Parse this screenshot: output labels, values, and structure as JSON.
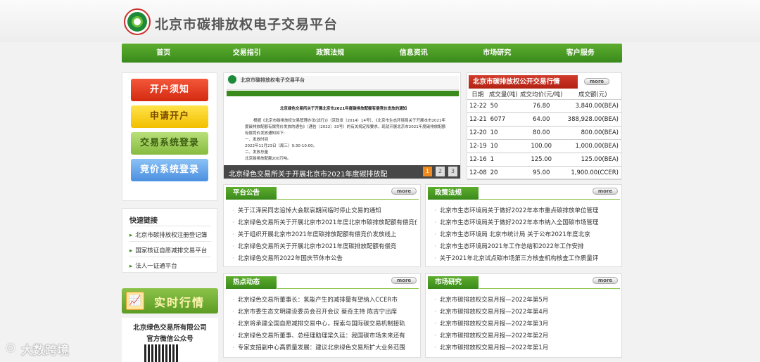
{
  "site_title": "北京市碳排放权电子交易平台",
  "nav": [
    "首页",
    "交易指引",
    "政策法规",
    "信息资讯",
    "市场研究",
    "客户服务"
  ],
  "buttons": {
    "open_notice": "开户须知",
    "apply": "申请开户",
    "trade_login": "交易系统登录",
    "bid_login": "竞价系统登录"
  },
  "quick_links": {
    "title": "快速链接",
    "items": [
      "北京市碳排放权注册登记簿",
      "国家核证自愿减排交易平台",
      "法人一证通平台"
    ]
  },
  "realtime": {
    "label": "实时行情"
  },
  "wechat": {
    "company": "北京绿色交易所有限公司",
    "label": "官方微信公众号"
  },
  "slide": {
    "site_title": "北京市碳排放权电子交易平台",
    "doc_title": "北京绿色交易所关于开展北京市2021年度碳排放配额有偿竞价发放的通知",
    "body": [
      "根据《北京市碳排放权交易管理办法(试行)》（京政发〔2014〕14号）、《北京市生态环境局关于开展本市2021年度碳排放配额有偿竞价发放的通告》（通告〔2022〕33号）的有关规定和要求，现就开展北京市2021年度碳排放配额有偿竞价发放通知如下:",
      "一、发放时间",
      "2022年11月23日（周三）9:30-10:00。",
      "二、发放总量",
      "北京碳排放配额200万吨。"
    ],
    "caption": "北京绿色交易所关于开展北京市2021年度碳排放配",
    "pages": [
      "1",
      "2",
      "3"
    ]
  },
  "market": {
    "title": "北京市碳排放权公开交易行情",
    "more": "more",
    "headers": [
      "日期",
      "成交量(吨)",
      "成交均价(元/吨)",
      "成交额(元)"
    ],
    "rows": [
      [
        "12-22",
        "50",
        "76.80",
        "3,840.00(BEA)"
      ],
      [
        "12-21",
        "6077",
        "64.00",
        "388,928.00(BEA)"
      ],
      [
        "12-20",
        "10",
        "80.00",
        "800.00(BEA)"
      ],
      [
        "12-19",
        "10",
        "100.00",
        "1,000.00(BEA)"
      ],
      [
        "12-16",
        "1",
        "125.00",
        "125.00(BEA)"
      ],
      [
        "12-08",
        "20",
        "95.00",
        "1,900.00(CCER)"
      ]
    ]
  },
  "announcements": {
    "title": "平台公告",
    "more": "more",
    "items": [
      "关于江泽民同志追悼大会默哀期间临时停止交易的通知",
      "北京绿色交易所关于开展北京市2021年度北京市碳排放配额有偿竞价发",
      "关于组织开展北京市2021年度碳排放配额有偿竞价发放线上",
      "北京绿色交易所关于开展北京市2021年度碳排放配额有偿竞",
      "北京绿色交易所2022年国庆节休市公告"
    ]
  },
  "policies": {
    "title": "政策法规",
    "more": "more",
    "items": [
      "北京市生态环境局关于做好2022年本市重点碳排放单位管理",
      "北京市生态环境局关于做好2022年本市纳入全国碳市场管理",
      "北京市生态环境局 北京市统计局 关于公布2021年度北京",
      "北京市生态环境局2021年工作总结和2022年工作安排",
      "关于2021年北京试点碳市场第三方核查机构核查工作质量评"
    ]
  },
  "hot": {
    "title": "热点动态",
    "more": "more",
    "items": [
      "北京绿色交易所董事长：氢能产生的减排量有望纳入CCER市",
      "北京市委生态文明建设委员会召开会议 蔡奇主持 陈吉宁出席",
      "北京将承建全国自愿减排交易中心，探索与国际碳交易机制接轨",
      "北京绿色交易所董事、总经理助理梁久廷：我国碳市场未来还有",
      "专家支招副中心高质量发展：建议北京绿色交易所扩大业务范围"
    ]
  },
  "research": {
    "title": "市场研究",
    "more": "more",
    "items": [
      "北京市碳排放权交易月报—2022年第5月",
      "北京市碳排放权交易月报—2022年第4月",
      "北京市碳排放权交易月报—2022年第3月",
      "北京市碳排放权交易月报—2022年第2月",
      "北京市碳排放权交易月报—2022年第1月"
    ]
  },
  "watermark": "大数跨境"
}
